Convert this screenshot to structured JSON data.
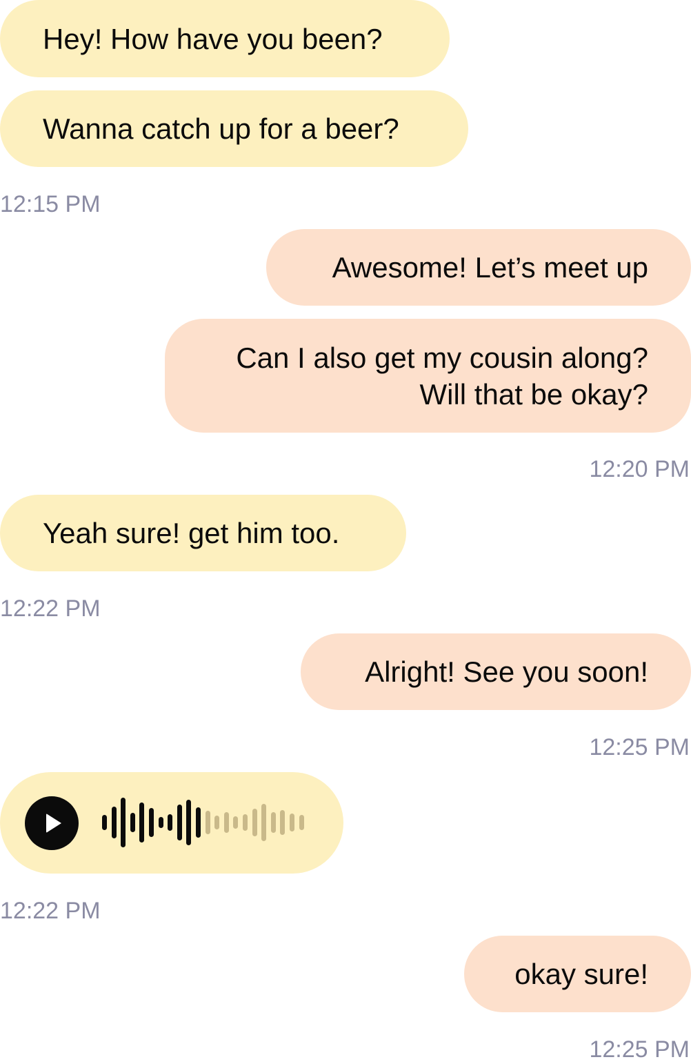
{
  "messages": [
    {
      "text": "Hey! How have you been?"
    },
    {
      "text": "Wanna catch up for a beer?"
    },
    {
      "text": "Awesome! Let’s meet up"
    },
    {
      "lines": [
        "Can I also get my cousin along?",
        "Will that be okay?"
      ]
    },
    {
      "text": "Yeah sure! get him too."
    },
    {
      "text": "Alright! See you soon!"
    },
    {
      "text": "okay sure!"
    }
  ],
  "timestamps": [
    "12:15 PM",
    "12:20 PM",
    "12:22 PM",
    "12:25 PM",
    "12:22 PM",
    "12:25 PM"
  ],
  "voice_message": {
    "icon": "play-icon",
    "played_fraction": 0.5
  },
  "colors": {
    "incoming_bubble": "#fdf0bf",
    "outgoing_bubble": "#fde0cc",
    "timestamp": "#8a8ba3",
    "wave_played": "#0b0b0b",
    "wave_unplayed": "#c9b98a"
  }
}
